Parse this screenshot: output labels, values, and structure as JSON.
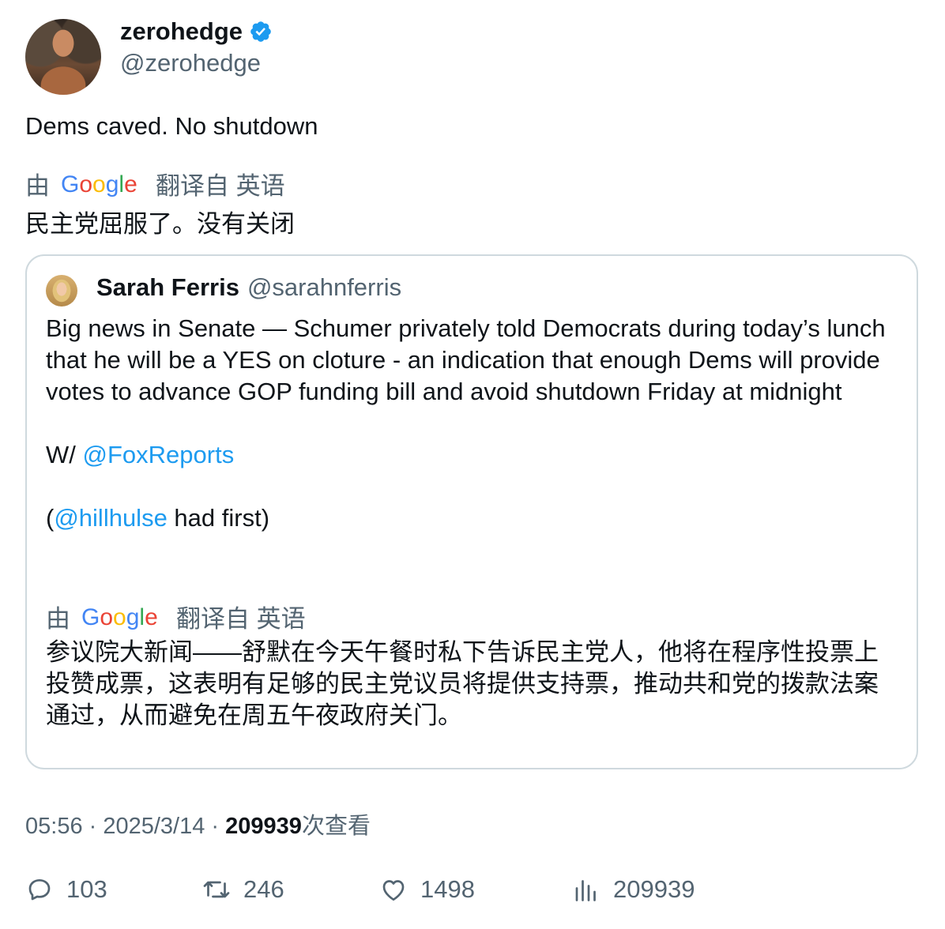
{
  "author": {
    "name": "zerohedge",
    "handle": "@zerohedge",
    "verified": true
  },
  "tweet": {
    "text": "Dems caved. No shutdown",
    "translation": {
      "by": "由",
      "provider": "Google",
      "from_label": "翻译自 英语",
      "text": "民主党屈服了。没有关闭"
    }
  },
  "quoted": {
    "name": "Sarah Ferris",
    "handle": "@sarahnferris",
    "text": "Big news in Senate — Schumer privately told Democrats during today’s lunch that he will be a YES on cloture - an indication that enough Dems will provide votes to advance GOP funding bill and avoid shutdown Friday at midnight",
    "with_prefix": "W/ ",
    "with_mention": "@FoxReports",
    "paren_open": "(",
    "credit_mention": "@hillhulse",
    "credit_suffix": " had first)",
    "translation": {
      "by": "由",
      "provider": "Google",
      "from_label": "翻译自 英语",
      "text": "参议院大新闻——舒默在今天午餐时私下告诉民主党人，他将在程序性投票上投赞成票，这表明有足够的民主党议员将提供支持票，推动共和党的拨款法案通过，从而避免在周五午夜政府关门。"
    }
  },
  "meta": {
    "time": "05:56",
    "sep1": " · ",
    "date": "2025/3/14",
    "sep2": " · ",
    "views": "209939",
    "views_suffix": "次查看"
  },
  "actions": {
    "replies": "103",
    "retweets": "246",
    "likes": "1498",
    "views": "209939"
  },
  "colors": {
    "link": "#1d9bf0",
    "muted": "#536471",
    "text": "#0f1419",
    "border": "#cfd9de"
  }
}
